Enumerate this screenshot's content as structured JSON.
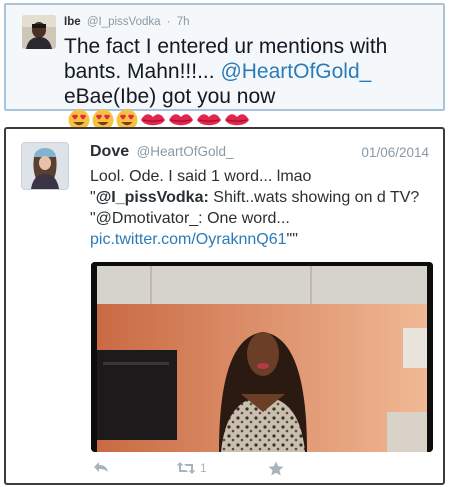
{
  "tweet1": {
    "name": "Ibe",
    "handle": "@I_pissVodka",
    "separator": "·",
    "time": "7h",
    "text_before": "The fact I entered ur mentions with bants. Mahn!!!...",
    "mention": "@HeartOfGold_",
    "text_after": "eBae(Ibe) got you now",
    "emojis": [
      "heart-eyes-icon",
      "heart-eyes-icon",
      "heart-eyes-icon",
      "kiss-lips-icon",
      "kiss-lips-icon",
      "kiss-lips-icon",
      "kiss-lips-icon"
    ]
  },
  "tweet2": {
    "name": "Dove",
    "handle": "@HeartOfGold_",
    "date": "01/06/2014",
    "line1": "Lool. Ode. I said 1 word... lmao",
    "quote_open": "\"",
    "quoted_handle": "@I_pissVodka:",
    "quoted_text": "Shift..wats showing on d TV? \"@Dmotivator_: One word...",
    "link": "pic.twitter.com/OyraknnQ61",
    "quote_close": "\"\"",
    "actions": {
      "reply_icon": "reply-icon",
      "retweet_icon": "retweet-icon",
      "retweet_count": "1",
      "favorite_icon": "star-icon"
    }
  },
  "colors": {
    "link": "#2b7bb9",
    "muted": "#8899a6",
    "card1_bg": "#f5f8fa",
    "card1_border": "#a9c4d9",
    "action_icons": "#a8b3bc"
  }
}
